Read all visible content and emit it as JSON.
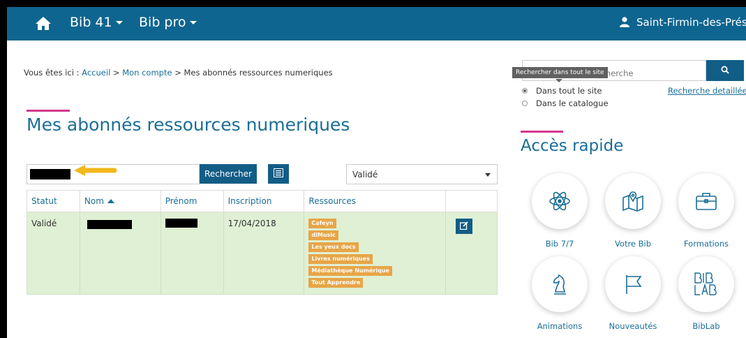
{
  "colors": {
    "primary": "#0e6590",
    "accent": "#d4378d",
    "row_success": "#dff0d4",
    "tag": "#e8a547"
  },
  "topbar": {
    "home_icon": "home-icon",
    "menu1": "Bib 41",
    "menu2": "Bib pro",
    "user_icon": "user-icon",
    "user": "Saint-Firmin-des-Prés"
  },
  "breadcrumb": {
    "prefix": "Vous êtes ici : ",
    "home": "Accueil",
    "sep1": " > ",
    "account": "Mon compte",
    "sep2": " > ",
    "current": "Mes abonnés ressources numeriques"
  },
  "page_title": "Mes abonnés ressources numeriques",
  "filter": {
    "search_button": "Rechercher",
    "status_select": "Validé"
  },
  "table": {
    "headers": [
      "Statut",
      "Nom",
      "Prénom",
      "Inscription",
      "Ressources"
    ],
    "rows": [
      {
        "statut": "Validé",
        "inscription": "17/04/2018",
        "ressources": [
          "Cafeyn",
          "diMusic",
          "Les yeux docs",
          "Livres numériques",
          "Médiathèque Numérique",
          "Tout Apprendre"
        ]
      }
    ]
  },
  "sidebar": {
    "search_placeholder": "Saisissez votre recherche",
    "tooltip": "Rechercher dans tout le site",
    "radio_site": "Dans tout le site",
    "radio_catalog": "Dans le catalogue",
    "advanced_link": "Recherche detaillée",
    "quick_title": "Accès rapide",
    "tiles": [
      "Bib 7/7",
      "Votre Bib",
      "Formations",
      "Animations",
      "Nouveautés",
      "BibLab"
    ]
  }
}
